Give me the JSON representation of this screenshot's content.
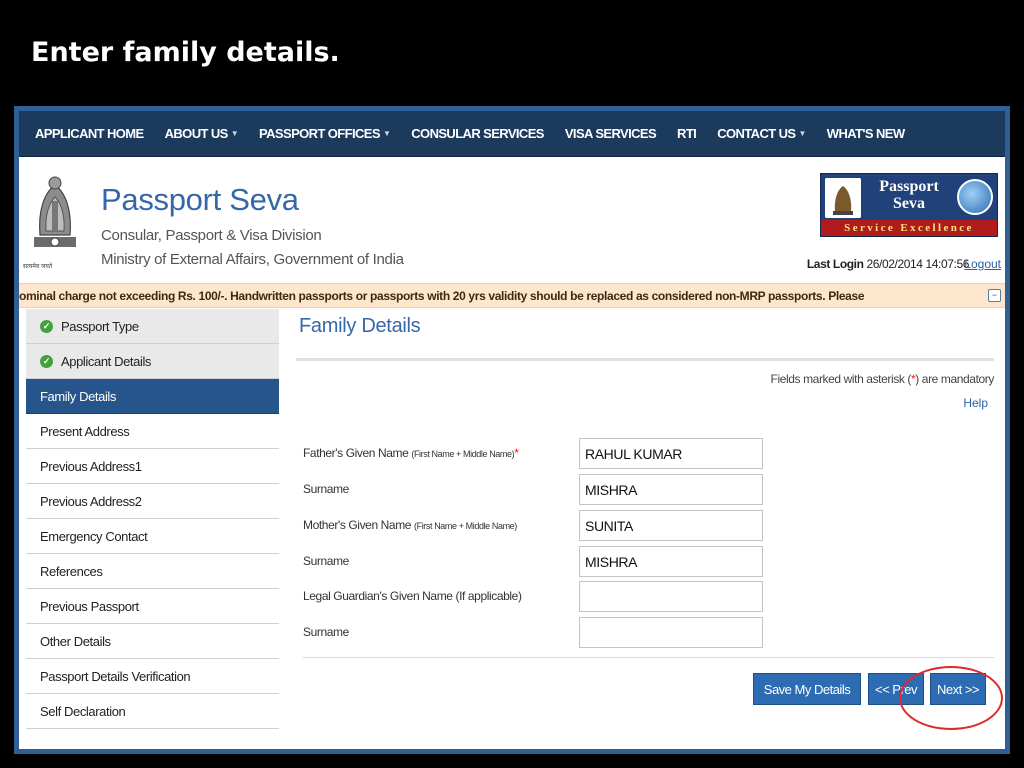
{
  "slide": {
    "title": "Enter family details."
  },
  "nav": {
    "items": [
      {
        "label": "APPLICANT HOME",
        "dropdown": false
      },
      {
        "label": "ABOUT US",
        "dropdown": true
      },
      {
        "label": "PASSPORT OFFICES",
        "dropdown": true
      },
      {
        "label": "CONSULAR SERVICES",
        "dropdown": false
      },
      {
        "label": "VISA SERVICES",
        "dropdown": false
      },
      {
        "label": "RTI",
        "dropdown": false
      },
      {
        "label": "CONTACT US",
        "dropdown": true
      },
      {
        "label": "WHAT'S NEW",
        "dropdown": false
      }
    ]
  },
  "header": {
    "title": "Passport Seva",
    "subtitle1": "Consular, Passport & Visa Division",
    "subtitle2": "Ministry of External Affairs, Government of India",
    "emblem_caption": "सत्यमेव जयते",
    "logo": {
      "line1": "Passport",
      "line2": "Seva",
      "strip": "Service Excellence"
    },
    "last_login_label": "Last Login",
    "last_login_value": "26/02/2014 14:07:56",
    "logout": "Logout"
  },
  "ticker": {
    "text": "ominal charge not exceeding Rs. 100/-. Handwritten passports or passports with 20 yrs validity should be replaced as considered non-MRP passports. Please"
  },
  "sidebar": {
    "items": [
      {
        "label": "Passport Type",
        "state": "done"
      },
      {
        "label": "Applicant Details",
        "state": "done"
      },
      {
        "label": "Family Details",
        "state": "active"
      },
      {
        "label": "Present Address",
        "state": "pending"
      },
      {
        "label": "Previous Address1",
        "state": "pending"
      },
      {
        "label": "Previous Address2",
        "state": "pending"
      },
      {
        "label": "Emergency Contact",
        "state": "pending"
      },
      {
        "label": "References",
        "state": "pending"
      },
      {
        "label": "Previous Passport",
        "state": "pending"
      },
      {
        "label": "Other Details",
        "state": "pending"
      },
      {
        "label": "Passport Details Verification",
        "state": "pending"
      },
      {
        "label": "Self Declaration",
        "state": "pending"
      }
    ]
  },
  "main": {
    "heading": "Family Details",
    "mandatory_prefix": "Fields marked with asterisk (",
    "mandatory_star": "*",
    "mandatory_suffix": ") are mandatory",
    "help": "Help",
    "fields": [
      {
        "label": "Father's Given Name",
        "hint": "(First Name + Middle Name)",
        "required": "*",
        "value": "RAHUL KUMAR"
      },
      {
        "label": "Surname",
        "hint": "",
        "required": "",
        "value": "MISHRA"
      },
      {
        "label": "Mother's Given Name",
        "hint": "(First Name + Middle Name)",
        "required": "",
        "value": "SUNITA"
      },
      {
        "label": "Surname",
        "hint": "",
        "required": "",
        "value": "MISHRA"
      },
      {
        "label": "Legal Guardian's Given Name (If applicable)",
        "hint": "",
        "required": "",
        "value": ""
      },
      {
        "label": "Surname",
        "hint": "",
        "required": "",
        "value": ""
      }
    ],
    "buttons": {
      "save": "Save My Details",
      "prev": "<< Prev",
      "next": "Next >>"
    }
  },
  "colors": {
    "nav_bg": "#1b3a5c",
    "active_item": "#26558b",
    "button": "#2d6bb2",
    "heading": "#3568a8",
    "highlight": "#e02a2a",
    "ticker_bg": "#fde6cc",
    "check": "#44a23d"
  }
}
